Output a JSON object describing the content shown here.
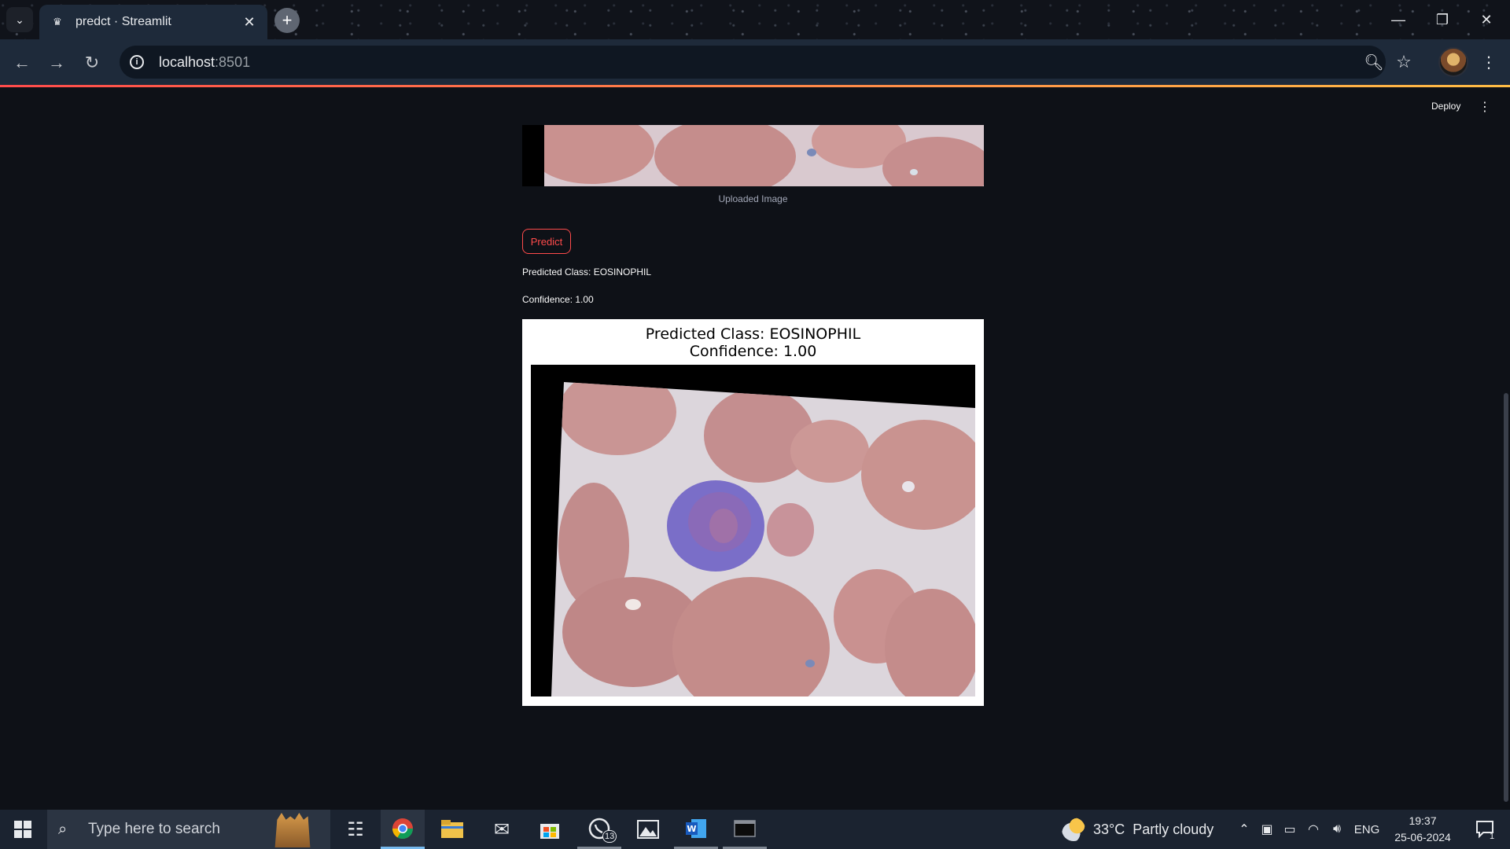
{
  "browser": {
    "tab_title": "predct · Streamlit",
    "url_host": "localhost",
    "url_port": ":8501",
    "window_controls": [
      "minimize-icon",
      "restore-icon",
      "close-icon"
    ]
  },
  "app": {
    "deploy_label": "Deploy",
    "uploaded_caption": "Uploaded Image",
    "predict_label": "Predict",
    "predicted_class_text": "Predicted Class: EOSINOPHIL",
    "confidence_text": "Confidence: 1.00",
    "figure": {
      "title_line1": "Predicted Class: EOSINOPHIL",
      "title_line2": "Confidence: 1.00"
    },
    "accent_color": "#ff4b4b",
    "background_color": "#0e1117"
  },
  "taskbar": {
    "search_placeholder": "Type here to search",
    "whatsapp_badge": "13",
    "weather": "33°C  Partly cloudy",
    "language": "ENG",
    "time": "19:37",
    "date": "25-06-2024",
    "notification_count": "1"
  }
}
